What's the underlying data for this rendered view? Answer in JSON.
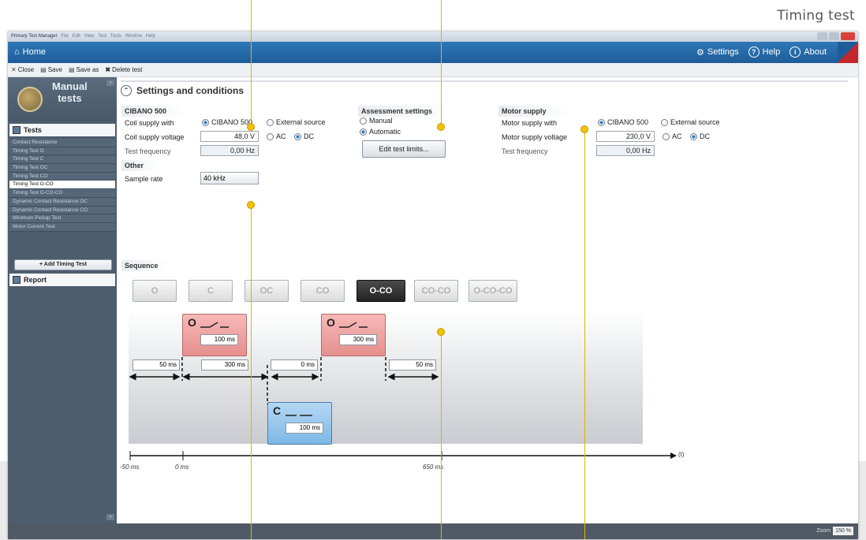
{
  "caption": "Timing test",
  "window": {
    "title": "Primary Test Manager",
    "menu": [
      "File",
      "Edit",
      "View",
      "Test",
      "Tools",
      "Window",
      "Help"
    ],
    "home_label": "Home",
    "nav": {
      "settings": "Settings",
      "help": "Help",
      "about": "About"
    }
  },
  "toolbar": {
    "close": "Close",
    "save": "Save",
    "save_as": "Save as",
    "delete": "Delete test"
  },
  "sidebar": {
    "title_line1": "Manual",
    "title_line2": "tests",
    "tests_header": "Tests",
    "items": [
      {
        "label": "Contact Resistance"
      },
      {
        "label": "Timing Test O"
      },
      {
        "label": "Timing Test C"
      },
      {
        "label": "Timing Test OC"
      },
      {
        "label": "Timing Test CO"
      },
      {
        "label": "Timing Test O-CO"
      },
      {
        "label": "Timing Test O-CO-CO"
      },
      {
        "label": "Dynamic Contact Resistance OC"
      },
      {
        "label": "Dynamic Contact Resistance CO"
      },
      {
        "label": "Minimum Pickup Test"
      },
      {
        "label": "Motor Current Test"
      }
    ],
    "active_index": 5,
    "add_button": "+ Add Timing Test",
    "report_header": "Report"
  },
  "settings": {
    "section_title": "Settings and conditions",
    "cibano": {
      "header": "CIBANO 500",
      "coil_supply_with_label": "Coil supply with",
      "opt_cibano": "CIBANO 500",
      "opt_external": "External source",
      "coil_voltage_label": "Coil supply voltage",
      "coil_voltage_value": "48,0 V",
      "opt_ac": "AC",
      "opt_dc": "DC",
      "test_freq_label": "Test frequency",
      "test_freq_value": "0,00 Hz"
    },
    "other": {
      "header": "Other",
      "sample_rate_label": "Sample rate",
      "sample_rate_value": "40 kHz"
    },
    "assessment": {
      "header": "Assessment settings",
      "opt_manual": "Manual",
      "opt_automatic": "Automatic",
      "edit_button": "Edit test limits..."
    },
    "motor": {
      "header": "Motor supply",
      "supply_with_label": "Motor supply with",
      "opt_cibano": "CIBANO 500",
      "opt_external": "External source",
      "voltage_label": "Motor supply voltage",
      "voltage_value": "230,0 V",
      "opt_ac": "AC",
      "opt_dc": "DC",
      "test_freq_label": "Test frequency",
      "test_freq_value": "0,00 Hz"
    }
  },
  "sequence": {
    "header": "Sequence",
    "buttons": [
      "O",
      "C",
      "OC",
      "CO",
      "O-CO",
      "CO-CO",
      "O-CO-CO"
    ],
    "active": "O-CO",
    "open1": {
      "symbol": "O",
      "value": "100 ms"
    },
    "open2": {
      "symbol": "O",
      "value": "300 ms"
    },
    "close": {
      "symbol": "C",
      "value": "100 ms"
    },
    "gaps": [
      "50 ms",
      "300 ms",
      "0 ms",
      "50 ms"
    ],
    "timeline": {
      "labels": [
        "-50 ms",
        "0 ms",
        "650 ms"
      ],
      "unit": "(t)"
    }
  },
  "status": {
    "zoom_label": "Zoom",
    "zoom_value": "150 %"
  },
  "colors": {
    "accent": "#1e5d99",
    "callout": "#f2c200",
    "open_box": "#f2a8a7",
    "close_box": "#9cc8ef"
  }
}
